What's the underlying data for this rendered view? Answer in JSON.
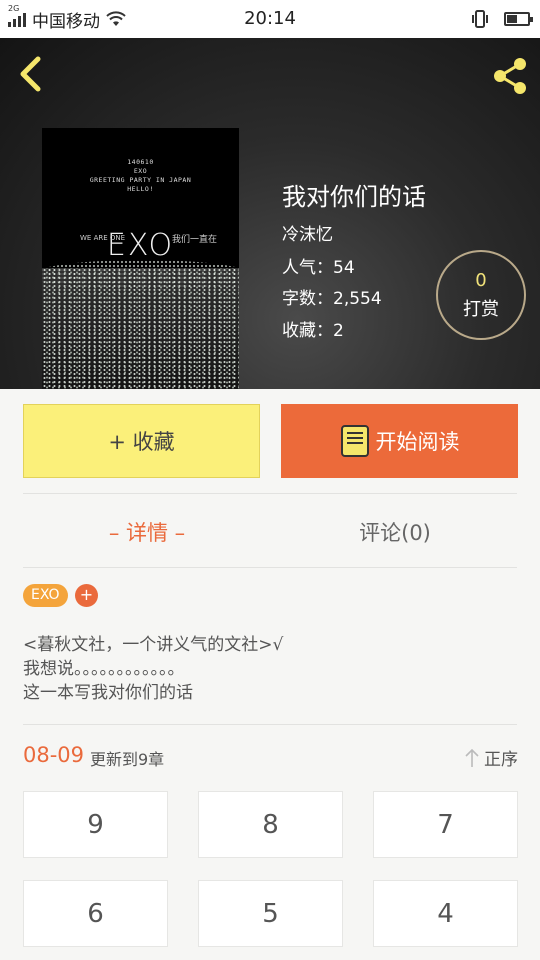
{
  "status_bar": {
    "network_tag": "2G",
    "carrier": "中国移动",
    "time": "20:14"
  },
  "cover": {
    "line1": "140610",
    "line2": "EXO",
    "line3": "GREETING PARTY IN JAPAN",
    "line4": "HELLO!",
    "logo": "EXO",
    "slogan_en": "WE ARE ONE",
    "slogan_cn": "我们一直在"
  },
  "book": {
    "title": "我对你们的话",
    "author": "冷沫忆",
    "popularity": "人气：54",
    "word_count": "字数：2,554",
    "favorites": "收藏：2",
    "tip_count": "0",
    "tip_label": "打赏"
  },
  "actions": {
    "favorite_label": "+ 收藏",
    "read_label": "开始阅读"
  },
  "tabs": {
    "detail": "– 详情 –",
    "comments": "评论(0)"
  },
  "tags": [
    "EXO"
  ],
  "tag_add": "+",
  "description": {
    "line1": "<暮秋文社，一个讲义气的文社>√",
    "line2": "我想说。。。。。。。。。。。。",
    "line3": "这一本写我对你们的话"
  },
  "chapters": {
    "update_date": "08-09",
    "update_text": "更新到9章",
    "sort_label": "正序",
    "items": [
      "9",
      "8",
      "7",
      "6",
      "5",
      "4"
    ]
  },
  "colors": {
    "accent_orange": "#ea6a3c",
    "favorite_yellow": "#fbf07a",
    "tag_orange": "#f4a43b",
    "icon_yellow": "#f5e66b"
  }
}
